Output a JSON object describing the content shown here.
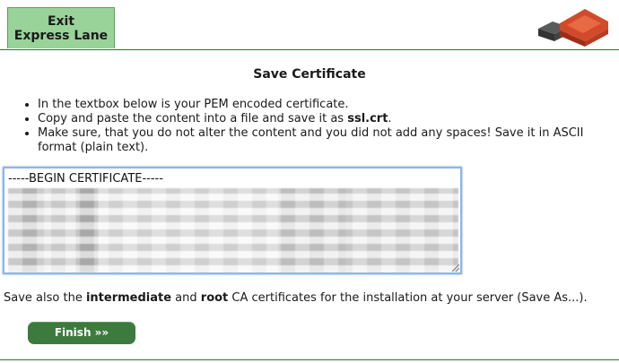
{
  "header": {
    "exit_line1": "Exit",
    "exit_line2": "Express Lane",
    "logo_icon": "brand-logo-icon"
  },
  "main": {
    "title": "Save Certificate",
    "instructions": [
      "In the textbox below is your PEM encoded certificate.",
      "Copy and paste the content into a file and save it as ",
      "Make sure, that you do not alter the content and you did not add any spaces! Save it in ASCII format (plain text)."
    ],
    "filename": "ssl.crt",
    "instruction_2_end": ".",
    "certificate_first_line": "-----BEGIN CERTIFICATE-----",
    "save_also_prefix": "Save also the ",
    "save_also_intermediate": "intermediate",
    "save_also_and": " and ",
    "save_also_root": "root",
    "save_also_suffix": " CA certificates for the installation at your server (Save As...).",
    "finish_label": "Finish »»"
  },
  "colors": {
    "exit_bg": "#99d399",
    "accent_green": "#3d7a3d",
    "rule_green": "#2f6f2f",
    "logo_red": "#d24a2a",
    "logo_gray": "#4a4a4a"
  }
}
